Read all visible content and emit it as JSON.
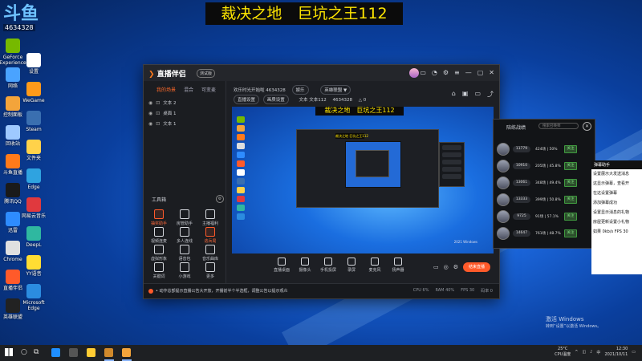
{
  "banner": {
    "text": "裁决之地　巨坑之王112"
  },
  "desktop": {
    "logo_text": "斗鱼",
    "room_id": "4634328",
    "icons": [
      {
        "label": "GeForce Experience",
        "color": "#76b900"
      },
      {
        "label": "网络",
        "color": "#4aa3ff"
      },
      {
        "label": "控制面板",
        "color": "#f3a43b"
      },
      {
        "label": "回收站",
        "color": "#9ec9ff"
      },
      {
        "label": "斗鱼直播",
        "color": "#ff7a1a"
      },
      {
        "label": "腾讯QQ",
        "color": "#1a1a1a"
      },
      {
        "label": "迅雷",
        "color": "#2e8cff"
      },
      {
        "label": "Chrome",
        "color": "#e0e0e0"
      },
      {
        "label": "直播伴侣",
        "color": "#ff5a2a"
      },
      {
        "label": "英雄联盟",
        "color": "#222"
      },
      {
        "label": "设置",
        "color": "#fff"
      },
      {
        "label": "WeGame",
        "color": "#ff9a1a"
      },
      {
        "label": "Steam",
        "color": "#3a6fb0"
      },
      {
        "label": "文件夹",
        "color": "#ffd24a"
      },
      {
        "label": "Edge",
        "color": "#2fa3e0"
      },
      {
        "label": "网易云音乐",
        "color": "#e0393e"
      },
      {
        "label": "DeepL",
        "color": "#2fb8a0"
      },
      {
        "label": "YY语音",
        "color": "#ffdd33"
      },
      {
        "label": "Microsoft Edge",
        "color": "#2b8ce0"
      }
    ]
  },
  "app": {
    "title": "直播伴侣",
    "badge": "测试版",
    "tabs": [
      {
        "label": "我的场景",
        "active": true
      },
      {
        "label": "混合",
        "active": false
      },
      {
        "label": "可变麦",
        "active": false
      }
    ],
    "scenes": [
      {
        "label": "文本 2"
      },
      {
        "label": "桌面 1"
      },
      {
        "label": "文本 1"
      }
    ],
    "tools_header": "工具箱",
    "tools": [
      {
        "label": "抽奖助手",
        "hot": true
      },
      {
        "label": "房管助手",
        "hot": false
      },
      {
        "label": "主播福利",
        "hot": false
      },
      {
        "label": "视频连麦",
        "hot": false
      },
      {
        "label": "多人连线",
        "hot": false
      },
      {
        "label": "逃兵局",
        "hot": true
      },
      {
        "label": "虚拟形象",
        "hot": false
      },
      {
        "label": "语音包",
        "hot": false
      },
      {
        "label": "音乐曲库",
        "hot": false
      },
      {
        "label": "关键词",
        "hot": false
      },
      {
        "label": "小游戏",
        "hot": false
      },
      {
        "label": "更多",
        "hot": false
      }
    ],
    "header": {
      "room_title": "欢乐时光开始啦 4634328",
      "room_tag": "娱乐",
      "category": "英雄联盟 ▼",
      "pills": [
        "直播设置",
        "画质设置"
      ],
      "source": "文本 文本112",
      "room_id": "4634328",
      "fans": "△ 0"
    },
    "preview": {
      "banner": "裁决之地　巨坑之王112",
      "nested_banner": "裁决之地 巨坑之王112",
      "corner_text": "2021 Windows"
    },
    "bottom_buttons": [
      {
        "label": "直播桌面"
      },
      {
        "label": "摄像头"
      },
      {
        "label": "手机投屏"
      },
      {
        "label": "录屏"
      },
      {
        "label": "麦克风"
      },
      {
        "label": "扬声器"
      }
    ],
    "start_live": "结束直播",
    "notice": "• 动作总部提示直播公告大开放，开播前半个半选框，调整公告以提示观众",
    "stats": [
      "CPU 6%",
      "RAM 40%",
      "FPS 30",
      "码率 0"
    ]
  },
  "rank": {
    "title": "陪练战绩",
    "search_placeholder": "搜索召唤师",
    "rows": [
      {
        "score": "11779",
        "games": "424场",
        "pct": "50%",
        "btn": "关注"
      },
      {
        "score": "10910",
        "games": "205场",
        "pct": "45.8%",
        "btn": "关注"
      },
      {
        "score": "13061",
        "games": "348场",
        "pct": "49.4%",
        "btn": "关注"
      },
      {
        "score": "13333",
        "games": "399场",
        "pct": "50.8%",
        "btn": "关注"
      },
      {
        "score": "9725",
        "games": "91场",
        "pct": "57.1%",
        "btn": "关注"
      },
      {
        "score": "14647",
        "games": "761场",
        "pct": "48.7%",
        "btn": "关注"
      }
    ]
  },
  "chat": {
    "header": "弹幕助手",
    "lines": [
      "设置展示大发送消息",
      "这显示弹幕，查看开",
      "在这设置弹幕",
      "添加弹幕成功",
      "设置显示消息的礼物",
      "房屋更新设置小礼物",
      "如果 0kb/s  FPS 30"
    ]
  },
  "watermark": {
    "line1": "激活 Windows",
    "line2": "转到“设置”以激活 Windows。"
  },
  "taskbar": {
    "weather_temp": "25°C",
    "weather_label": "CPU温度",
    "time": "12:30",
    "date": "2021/10/11",
    "icons": [
      {
        "color": "#1f8fff"
      },
      {
        "color": "#555"
      },
      {
        "color": "#ffcc33"
      },
      {
        "color": "#d0892b"
      },
      {
        "color": "#f3a43b"
      }
    ]
  }
}
